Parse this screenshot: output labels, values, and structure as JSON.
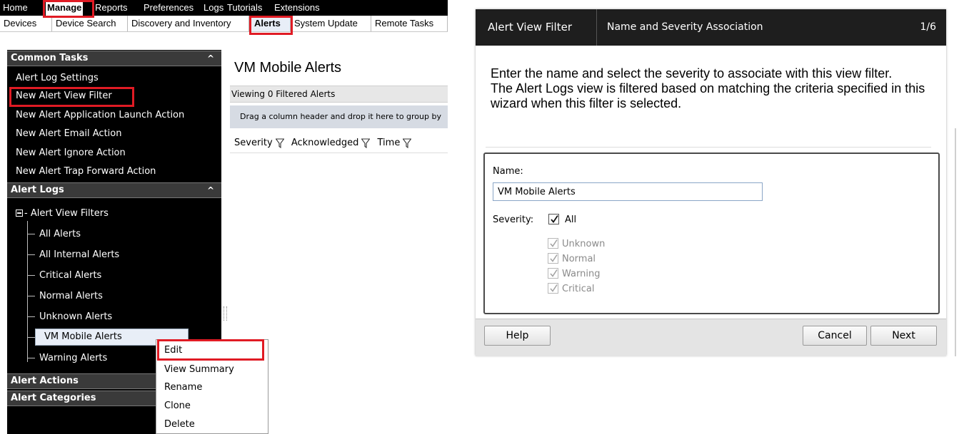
{
  "menu": {
    "items": [
      "Home",
      "Manage",
      "Reports",
      "Preferences",
      "Logs",
      "Tutorials",
      "Extensions"
    ],
    "active": "Manage"
  },
  "tabs": {
    "items": [
      "Devices",
      "Device Search",
      "Discovery and Inventory",
      "Alerts",
      "System Update",
      "Remote Tasks"
    ],
    "active": "Alerts"
  },
  "sidebar": {
    "common_tasks": {
      "title": "Common Tasks",
      "items": [
        "Alert Log Settings",
        "New Alert View Filter",
        "New Alert Application Launch Action",
        "New Alert Email Action",
        "New Alert Ignore Action",
        "New Alert Trap Forward Action"
      ]
    },
    "alert_logs": {
      "title": "Alert Logs",
      "root": "Alert View Filters",
      "items": [
        "All Alerts",
        "All Internal Alerts",
        "Critical Alerts",
        "Normal Alerts",
        "Unknown Alerts",
        "VM Mobile Alerts",
        "Warning Alerts"
      ],
      "selected": "VM Mobile Alerts"
    },
    "alert_actions": "Alert Actions",
    "alert_categories": "Alert Categories"
  },
  "content": {
    "title": "VM Mobile Alerts",
    "viewing": "Viewing 0 Filtered Alerts",
    "group_hint": "Drag a column header and drop it here to group by",
    "columns": [
      "Severity",
      "Acknowledged",
      "Time"
    ]
  },
  "context_menu": {
    "items": [
      "Edit",
      "View Summary",
      "Rename",
      "Clone",
      "Delete"
    ],
    "highlighted": "Edit"
  },
  "dialog": {
    "title": "Alert View Filter",
    "step": "Name and Severity Association",
    "page": "1/6",
    "intro_1": "Enter the name and select the severity to associate with this view filter.",
    "intro_2": "The Alert Logs view is filtered based on matching the criteria specified in this wizard when this filter is selected.",
    "name_label": "Name:",
    "name_value": "VM Mobile Alerts",
    "severity_label": "Severity:",
    "all_label": "All",
    "all_checked": true,
    "severities": [
      "Unknown",
      "Normal",
      "Warning",
      "Critical"
    ],
    "help": "Help",
    "cancel": "Cancel",
    "next": "Next"
  },
  "colors": {
    "highlight_red": "#e01b24",
    "sidebar_bg": "#000000",
    "dialog_header": "#1e1e1e"
  }
}
